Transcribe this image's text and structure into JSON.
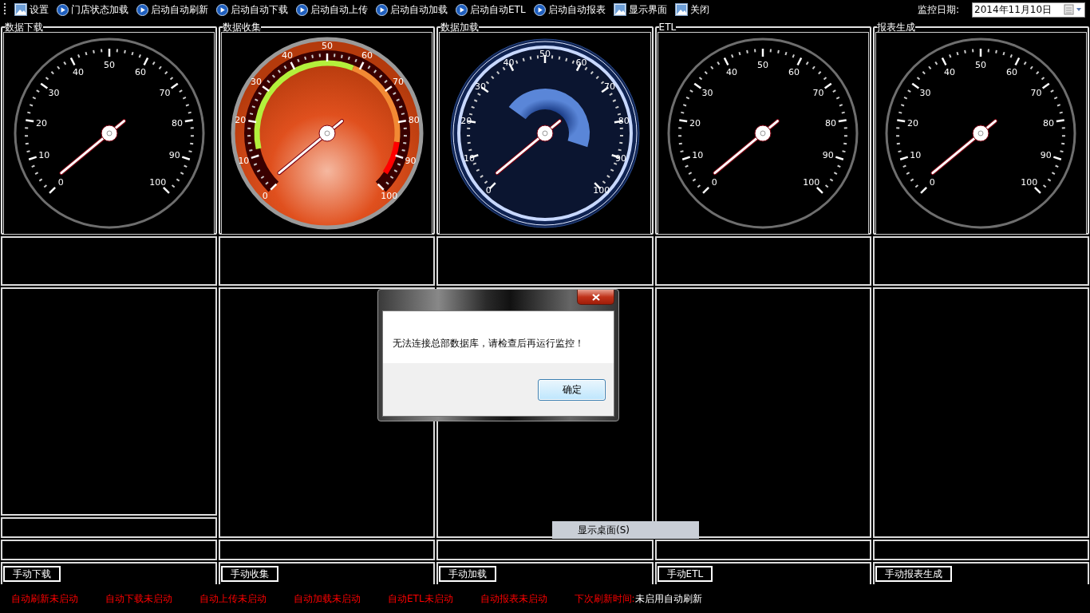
{
  "toolbar": {
    "items": [
      {
        "label": "设置",
        "kind": "picture"
      },
      {
        "label": "门店状态加载",
        "kind": "play"
      },
      {
        "label": "启动自动刷新",
        "kind": "play"
      },
      {
        "label": "启动自动下载",
        "kind": "play"
      },
      {
        "label": "启动自动上传",
        "kind": "play"
      },
      {
        "label": "启动自动加载",
        "kind": "play"
      },
      {
        "label": "启动自动ETL",
        "kind": "play"
      },
      {
        "label": "启动自动报表",
        "kind": "play"
      },
      {
        "label": "显示界面",
        "kind": "picture"
      },
      {
        "label": "关闭",
        "kind": "picture"
      }
    ],
    "date_label": "监控日期:",
    "date_value": "2014年11月10日"
  },
  "columns": [
    {
      "title": "数据下载",
      "gauge": {
        "kind": "plain",
        "scale": [
          "0",
          "10",
          "20",
          "30",
          "40",
          "50",
          "60",
          "70",
          "80",
          "90",
          "100"
        ]
      },
      "extra_row": true,
      "button": "手动下载"
    },
    {
      "title": "数据收集",
      "gauge": {
        "kind": "orange",
        "scale": [
          "0",
          "10",
          "20",
          "30",
          "40",
          "50",
          "60",
          "70",
          "80",
          "90",
          "100"
        ]
      },
      "button": "手动收集"
    },
    {
      "title": "数据加载",
      "gauge": {
        "kind": "blue",
        "scale": [
          "0",
          "10",
          "20",
          "30",
          "40",
          "50",
          "60",
          "70",
          "80",
          "90",
          "100"
        ]
      },
      "button": "手动加载"
    },
    {
      "title": "ETL",
      "gauge": {
        "kind": "plain",
        "scale": [
          "0",
          "10",
          "20",
          "30",
          "40",
          "50",
          "60",
          "70",
          "80",
          "90",
          "100"
        ]
      },
      "button": "手动ETL"
    },
    {
      "title": "报表生成",
      "gauge": {
        "kind": "plain",
        "scale": [
          "0",
          "10",
          "20",
          "30",
          "40",
          "50",
          "60",
          "70",
          "80",
          "90",
          "100"
        ]
      },
      "button": "手动报表生成"
    }
  ],
  "status_bar": [
    {
      "text": "自动刷新未启动"
    },
    {
      "text": "自动下载未启动"
    },
    {
      "text": "自动上传未启动"
    },
    {
      "text": "自动加载未启动"
    },
    {
      "text": "自动ETL未启动"
    },
    {
      "text": "自动报表未启动"
    },
    {
      "text": "下次刷新时间:",
      "value": "未启用自动刷新"
    }
  ],
  "popup_menu": {
    "items": [
      "显示桌面(S)"
    ]
  },
  "dialog": {
    "message": "无法连接总部数据库，请检查后再运行监控！",
    "button": "确定"
  }
}
